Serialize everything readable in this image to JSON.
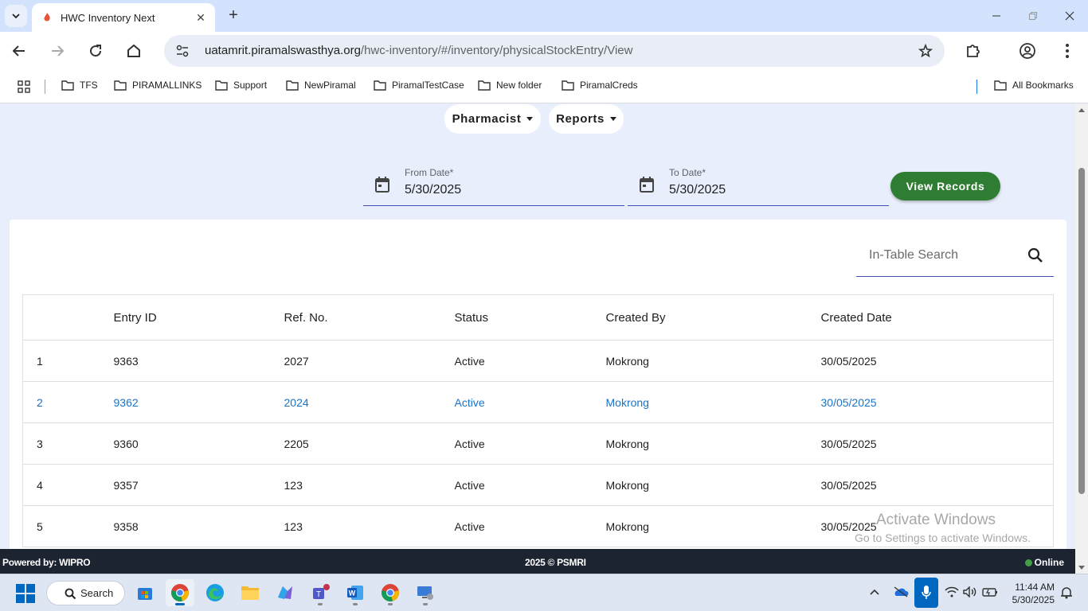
{
  "browser": {
    "tab_title": "HWC Inventory Next",
    "url_host": "uatamrit.piramalswasthya.org",
    "url_path": "/hwc-inventory/#/inventory/physicalStockEntry/View",
    "bookmarks": [
      "TFS",
      "PIRAMALLINKS",
      "Support",
      "NewPiramal",
      "PiramalTestCase",
      "New folder",
      "PiramalCreds"
    ],
    "all_bookmarks": "All Bookmarks"
  },
  "nav": {
    "pharmacist": "Pharmacist",
    "reports": "Reports"
  },
  "filters": {
    "from_label": "From Date*",
    "from_value": "5/30/2025",
    "to_label": "To Date*",
    "to_value": "5/30/2025",
    "view_button": "View Records"
  },
  "search": {
    "placeholder": "In-Table Search"
  },
  "table": {
    "headers": [
      "",
      "Entry ID",
      "Ref. No.",
      "Status",
      "Created By",
      "Created Date"
    ],
    "rows": [
      [
        "1",
        "9363",
        "2027",
        "Active",
        "Mokrong",
        "30/05/2025"
      ],
      [
        "2",
        "9362",
        "2024",
        "Active",
        "Mokrong",
        "30/05/2025"
      ],
      [
        "3",
        "9360",
        "2205",
        "Active",
        "Mokrong",
        "30/05/2025"
      ],
      [
        "4",
        "9357",
        "123",
        "Active",
        "Mokrong",
        "30/05/2025"
      ],
      [
        "5",
        "9358",
        "123",
        "Active",
        "Mokrong",
        "30/05/2025"
      ]
    ]
  },
  "watermark": {
    "line1": "Activate Windows",
    "line2": "Go to Settings to activate Windows."
  },
  "footer": {
    "powered": "Powered by: WIPRO",
    "copyright": "2025 © PSMRI",
    "status": "Online"
  },
  "taskbar": {
    "search": "Search",
    "time": "11:44 AM",
    "date": "5/30/2025"
  },
  "colors": {
    "accent_green": "#2e7d32",
    "link_blue": "#1a73c8",
    "footer_bg": "#1c2331"
  }
}
